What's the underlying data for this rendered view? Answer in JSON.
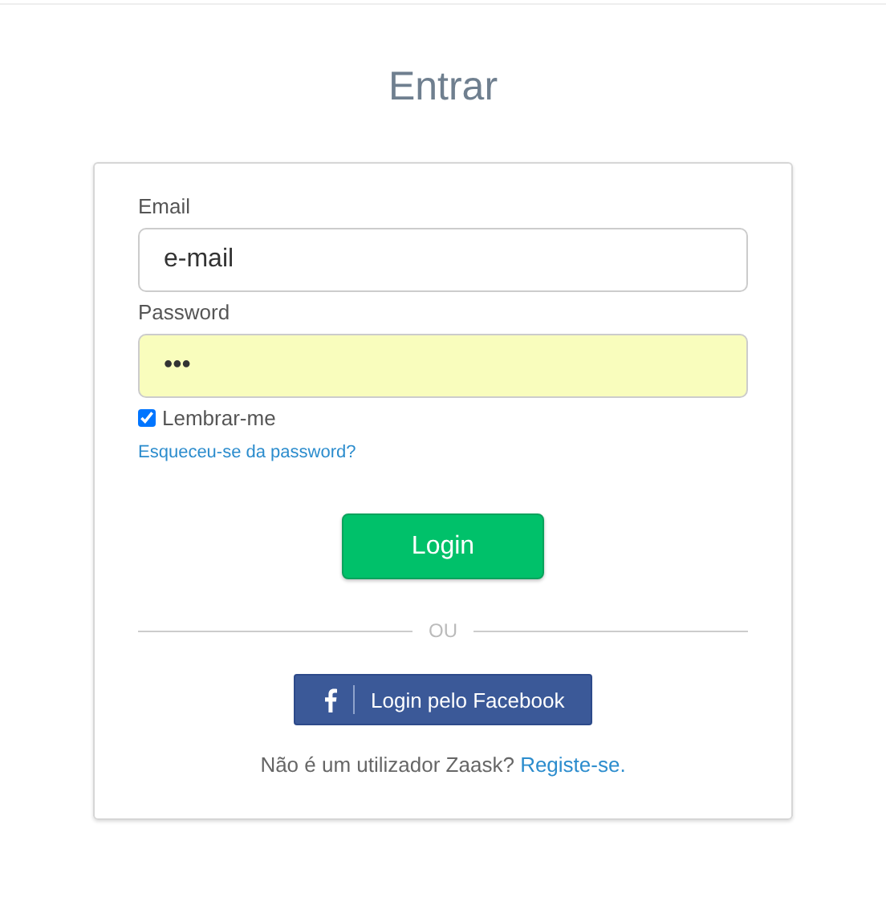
{
  "title": "Entrar",
  "form": {
    "email": {
      "label": "Email",
      "value": "e-mail"
    },
    "password": {
      "label": "Password",
      "value": "•••",
      "autofilled": true
    },
    "remember": {
      "label": "Lembrar-me",
      "checked": true
    },
    "forgot_link": "Esqueceu-se da password?",
    "login_button": "Login",
    "divider": "OU",
    "facebook_button": "Login pelo Facebook",
    "signup": {
      "text": "Não é um utilizador Zaask?",
      "link": "Registe-se."
    }
  }
}
